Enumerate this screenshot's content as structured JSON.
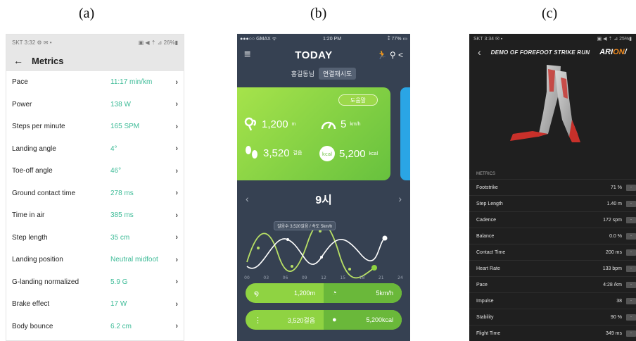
{
  "labels": {
    "a": "(a)",
    "b": "(b)",
    "c": "(c)"
  },
  "panel_a": {
    "status_left": "SKT 3:32 ⚙ ✉ •",
    "status_right": "▣ ◀ ⇡ ⊿ 26%▮",
    "back_icon": "←",
    "title": "Metrics",
    "rows": [
      {
        "label": "Pace",
        "value": "11:17 min/km"
      },
      {
        "label": "Power",
        "value": "138 W"
      },
      {
        "label": "Steps per minute",
        "value": "165 SPM"
      },
      {
        "label": "Landing angle",
        "value": "4°"
      },
      {
        "label": "Toe-off angle",
        "value": "46°"
      },
      {
        "label": "Ground contact time",
        "value": "278 ms"
      },
      {
        "label": "Time in air",
        "value": "385 ms"
      },
      {
        "label": "Step length",
        "value": "35 cm"
      },
      {
        "label": "Landing position",
        "value": "Neutral midfoot"
      },
      {
        "label": "G-landing normalized",
        "value": "5.9 G"
      },
      {
        "label": "Brake effect",
        "value": "17 W"
      },
      {
        "label": "Body bounce",
        "value": "6.2 cm"
      }
    ],
    "chevron": "›"
  },
  "panel_b": {
    "status_left": "●●●○○ GMAX ᯤ",
    "status_time": "1:20 PM",
    "status_right": "⁑ 77% ▭",
    "menu_icon": "≡",
    "title": "TODAY",
    "nav_icons": "🏃 ⚲ <",
    "user": "홍길동님",
    "connect": "연결재시도",
    "help": "도움말",
    "distance": "1,200",
    "distance_unit": "m",
    "speed": "5",
    "speed_unit": "km/h",
    "steps": "3,520",
    "steps_unit": "걸음",
    "kcal": "5,200",
    "kcal_unit": "kcal",
    "hour": "9시",
    "prev": "‹",
    "next": "›",
    "bubble": "걸음수 3,520걸음 / 속도 5km/h",
    "x_ticks": [
      "00",
      "03",
      "06",
      "09",
      "12",
      "15",
      "18",
      "21",
      "24"
    ],
    "pill1_left": "1,200m",
    "pill1_right": "5km/h",
    "pill2_left": "3,520걸음",
    "pill2_right": "5,200kcal"
  },
  "panel_c": {
    "status_left": "SKT 3:34 ✉ ▪",
    "status_right": "▣ ◀ ⇡ ⊿ 25%▮",
    "back_icon": "‹",
    "title": "DEMO OF FOREFOOT STRIKE RUN",
    "logo_left": "ARI",
    "logo_accent": "ON",
    "logo_right": "/",
    "metrics_label": "METRICS",
    "rows": [
      {
        "label": "Footstrike",
        "value": "71 %"
      },
      {
        "label": "Step Length",
        "value": "1.40 m"
      },
      {
        "label": "Cadence",
        "value": "172 spm"
      },
      {
        "label": "Balance",
        "value": "0.0 %"
      },
      {
        "label": "Contact Time",
        "value": "200 ms"
      },
      {
        "label": "Heart Rate",
        "value": "133 bpm"
      },
      {
        "label": "Pace",
        "value": "4:28 /km"
      },
      {
        "label": "Impulse",
        "value": "38"
      },
      {
        "label": "Stability",
        "value": "90 %"
      },
      {
        "label": "Flight Time",
        "value": "349 ms"
      }
    ],
    "row_button": "-"
  }
}
